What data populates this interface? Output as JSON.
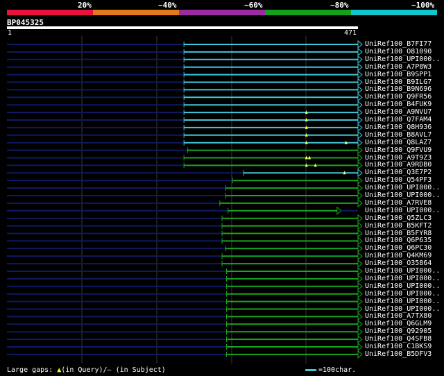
{
  "legend": {
    "colors": [
      "#e8133b",
      "#e07a1a",
      "#9a2ea0",
      "#14a01c",
      "#12c6c9"
    ],
    "labels": [
      "20%",
      "~40%",
      "~60%",
      "~80%",
      "~100%"
    ]
  },
  "query": {
    "name": "BP045325",
    "start_label": "1",
    "end_label": "471",
    "length": 471
  },
  "colors": {
    "high_identity": "#41c7d8",
    "mid_identity": "#18a61c",
    "unaligned": "#0d1a66",
    "gap_marker": "#ffff66"
  },
  "hits": [
    {
      "name": "UniRef100_B7FI77",
      "start": 238,
      "end": 471,
      "color": "#41c7d8",
      "gaps": []
    },
    {
      "name": "UniRef100_O81090",
      "start": 238,
      "end": 471,
      "color": "#41c7d8",
      "gaps": []
    },
    {
      "name": "UniRef100_UPI000..",
      "start": 238,
      "end": 471,
      "color": "#41c7d8",
      "gaps": []
    },
    {
      "name": "UniRef100_A7P8W3",
      "start": 238,
      "end": 471,
      "color": "#41c7d8",
      "gaps": []
    },
    {
      "name": "UniRef100_B9SPP1",
      "start": 238,
      "end": 471,
      "color": "#41c7d8",
      "gaps": []
    },
    {
      "name": "UniRef100_B9ILG7",
      "start": 238,
      "end": 471,
      "color": "#41c7d8",
      "gaps": []
    },
    {
      "name": "UniRef100_B9N696",
      "start": 238,
      "end": 471,
      "color": "#41c7d8",
      "gaps": []
    },
    {
      "name": "UniRef100_Q9FR56",
      "start": 238,
      "end": 471,
      "color": "#41c7d8",
      "gaps": []
    },
    {
      "name": "UniRef100_B4FUK9",
      "start": 238,
      "end": 471,
      "color": "#41c7d8",
      "gaps": []
    },
    {
      "name": "UniRef100_A9NVU7",
      "start": 238,
      "end": 471,
      "color": "#41c7d8",
      "gaps": [
        402
      ]
    },
    {
      "name": "UniRef100_Q7FAM4",
      "start": 238,
      "end": 471,
      "color": "#41c7d8",
      "gaps": [
        402
      ]
    },
    {
      "name": "UniRef100_Q8H936",
      "start": 238,
      "end": 471,
      "color": "#41c7d8",
      "gaps": [
        402
      ]
    },
    {
      "name": "UniRef100_B8AVL7",
      "start": 238,
      "end": 471,
      "color": "#41c7d8",
      "gaps": [
        402
      ]
    },
    {
      "name": "UniRef100_Q8LAZ7",
      "start": 238,
      "end": 471,
      "color": "#41c7d8",
      "gaps": [
        402,
        455
      ]
    },
    {
      "name": "UniRef100_Q9FVU9",
      "start": 243,
      "end": 471,
      "color": "#18a61c",
      "gaps": []
    },
    {
      "name": "UniRef100_A9T9Z3",
      "start": 238,
      "end": 471,
      "color": "#18a61c",
      "gaps": [
        402,
        406
      ]
    },
    {
      "name": "UniRef100_A9RDB0",
      "start": 238,
      "end": 471,
      "color": "#18a61c",
      "gaps": [
        402,
        414
      ]
    },
    {
      "name": "UniRef100_Q3E7P2",
      "start": 318,
      "end": 471,
      "color": "#41c7d8",
      "gaps": [
        453
      ]
    },
    {
      "name": "UniRef100_Q54PF3",
      "start": 303,
      "end": 471,
      "color": "#18a61c",
      "gaps": []
    },
    {
      "name": "UniRef100_UPI000..",
      "start": 294,
      "end": 471,
      "color": "#18a61c",
      "gaps": []
    },
    {
      "name": "UniRef100_UPI000..",
      "start": 294,
      "end": 471,
      "color": "#18a61c",
      "gaps": []
    },
    {
      "name": "UniRef100_A7RVE8",
      "start": 286,
      "end": 471,
      "color": "#18a61c",
      "gaps": []
    },
    {
      "name": "UniRef100_UPI000..",
      "start": 297,
      "end": 443,
      "color": "#18a61c",
      "gaps": []
    },
    {
      "name": "UniRef100_Q5ZLC3",
      "start": 289,
      "end": 471,
      "color": "#18a61c",
      "gaps": []
    },
    {
      "name": "UniRef100_B5KFT2",
      "start": 289,
      "end": 471,
      "color": "#18a61c",
      "gaps": []
    },
    {
      "name": "UniRef100_B5FYR8",
      "start": 289,
      "end": 471,
      "color": "#18a61c",
      "gaps": []
    },
    {
      "name": "UniRef100_Q6P635",
      "start": 289,
      "end": 471,
      "color": "#18a61c",
      "gaps": []
    },
    {
      "name": "UniRef100_Q6PC30",
      "start": 294,
      "end": 471,
      "color": "#18a61c",
      "gaps": []
    },
    {
      "name": "UniRef100_Q4KM69",
      "start": 289,
      "end": 471,
      "color": "#18a61c",
      "gaps": []
    },
    {
      "name": "UniRef100_O35864",
      "start": 289,
      "end": 471,
      "color": "#18a61c",
      "gaps": []
    },
    {
      "name": "UniRef100_UPI000..",
      "start": 295,
      "end": 471,
      "color": "#18a61c",
      "gaps": []
    },
    {
      "name": "UniRef100_UPI000..",
      "start": 295,
      "end": 471,
      "color": "#18a61c",
      "gaps": []
    },
    {
      "name": "UniRef100_UPI000..",
      "start": 295,
      "end": 471,
      "color": "#18a61c",
      "gaps": []
    },
    {
      "name": "UniRef100_UPI000..",
      "start": 295,
      "end": 471,
      "color": "#18a61c",
      "gaps": []
    },
    {
      "name": "UniRef100_UPI000..",
      "start": 295,
      "end": 471,
      "color": "#18a61c",
      "gaps": []
    },
    {
      "name": "UniRef100_UPI000..",
      "start": 295,
      "end": 471,
      "color": "#18a61c",
      "gaps": []
    },
    {
      "name": "UniRef100_A7TX80",
      "start": 295,
      "end": 471,
      "color": "#18a61c",
      "gaps": []
    },
    {
      "name": "UniRef100_Q6GLM9",
      "start": 295,
      "end": 471,
      "color": "#18a61c",
      "gaps": []
    },
    {
      "name": "UniRef100_Q92905",
      "start": 295,
      "end": 471,
      "color": "#18a61c",
      "gaps": []
    },
    {
      "name": "UniRef100_Q4SFB8",
      "start": 295,
      "end": 471,
      "color": "#18a61c",
      "gaps": []
    },
    {
      "name": "UniRef100_C1BKS9",
      "start": 295,
      "end": 471,
      "color": "#18a61c",
      "gaps": []
    },
    {
      "name": "UniRef100_B5DFV3",
      "start": 295,
      "end": 471,
      "color": "#18a61c",
      "gaps": []
    }
  ],
  "footer": {
    "gaps_label": "Large gaps:",
    "query_marker": "▲",
    "query_text": "(in Query)/",
    "subject_marker": "–",
    "subject_text": " (in Subject)",
    "scale_text": "=100char."
  }
}
